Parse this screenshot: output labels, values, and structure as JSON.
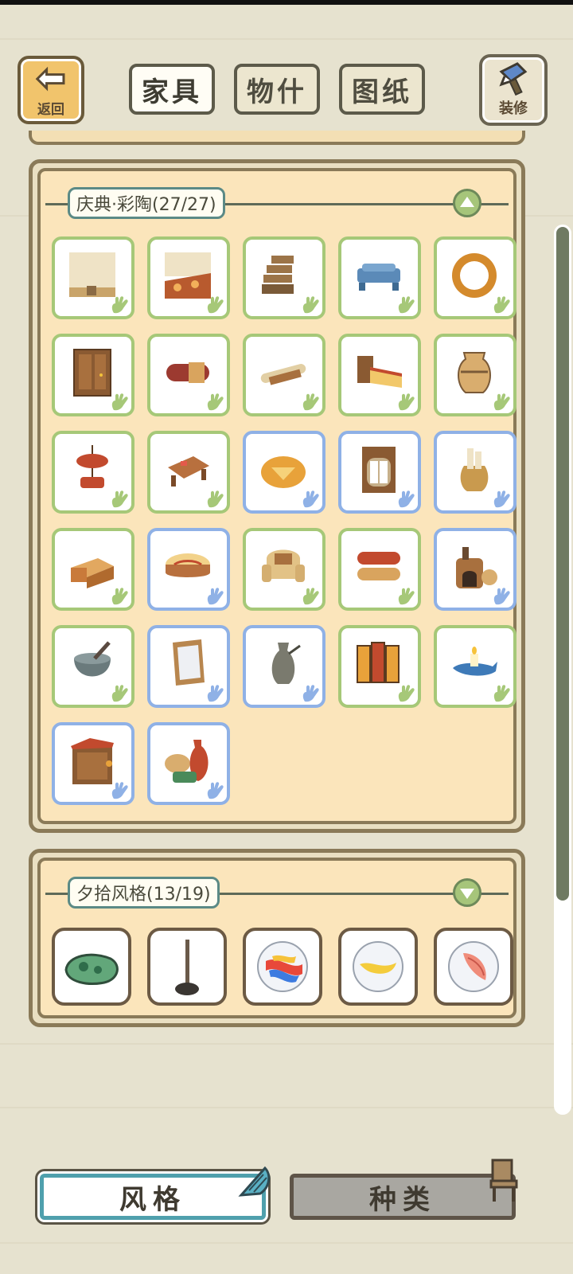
{
  "topbar": {
    "back_label": "返回",
    "tabs": [
      {
        "label": "家具",
        "active": true
      },
      {
        "label": "物什",
        "active": false
      },
      {
        "label": "图纸",
        "active": false
      }
    ],
    "decorate_label": "装修"
  },
  "sections": [
    {
      "title": "庆典·彩陶(27/27)",
      "expanded": true,
      "items": [
        {
          "icon": "wall-panel-icon",
          "frame": "green"
        },
        {
          "icon": "patterned-rug-icon",
          "frame": "green"
        },
        {
          "icon": "wooden-stairs-icon",
          "frame": "green"
        },
        {
          "icon": "blue-bench-icon",
          "frame": "green"
        },
        {
          "icon": "round-mirror-icon",
          "frame": "green"
        },
        {
          "icon": "wooden-door-icon",
          "frame": "green"
        },
        {
          "icon": "cushion-roll-icon",
          "frame": "green"
        },
        {
          "icon": "rolled-carpet-icon",
          "frame": "green"
        },
        {
          "icon": "ornate-bed-icon",
          "frame": "green"
        },
        {
          "icon": "clay-vase-icon",
          "frame": "green"
        },
        {
          "icon": "hanging-sign-icon",
          "frame": "green"
        },
        {
          "icon": "low-table-icon",
          "frame": "green"
        },
        {
          "icon": "round-cushion-icon",
          "frame": "blue"
        },
        {
          "icon": "cabinet-icon",
          "frame": "blue"
        },
        {
          "icon": "scroll-jar-icon",
          "frame": "blue"
        },
        {
          "icon": "open-box-icon",
          "frame": "green"
        },
        {
          "icon": "round-table-icon",
          "frame": "blue"
        },
        {
          "icon": "armchair-icon",
          "frame": "green"
        },
        {
          "icon": "rug-rolls-icon",
          "frame": "green"
        },
        {
          "icon": "pottery-kiln-icon",
          "frame": "blue"
        },
        {
          "icon": "mortar-pot-icon",
          "frame": "green"
        },
        {
          "icon": "standing-mirror-icon",
          "frame": "blue"
        },
        {
          "icon": "ewer-icon",
          "frame": "blue"
        },
        {
          "icon": "folding-screen-icon",
          "frame": "green"
        },
        {
          "icon": "oil-lamp-icon",
          "frame": "green"
        },
        {
          "icon": "dresser-icon",
          "frame": "blue"
        },
        {
          "icon": "pottery-set-icon",
          "frame": "blue"
        }
      ]
    },
    {
      "title": "夕拾风格(13/19)",
      "expanded": false,
      "items": [
        {
          "icon": "jade-stone-icon"
        },
        {
          "icon": "stick-stand-icon"
        },
        {
          "icon": "rainbow-marble-icon"
        },
        {
          "icon": "yellow-marble-icon"
        },
        {
          "icon": "shell-marble-icon"
        }
      ]
    }
  ],
  "bottom": {
    "style_label": "风格",
    "type_label": "种类"
  },
  "colors": {
    "frame_green": "#a6c878",
    "frame_blue": "#8fb1e6",
    "panel_fill": "#fbe5bb",
    "title_border": "#5b8a86",
    "scroll_thumb": "#6f7a62"
  }
}
